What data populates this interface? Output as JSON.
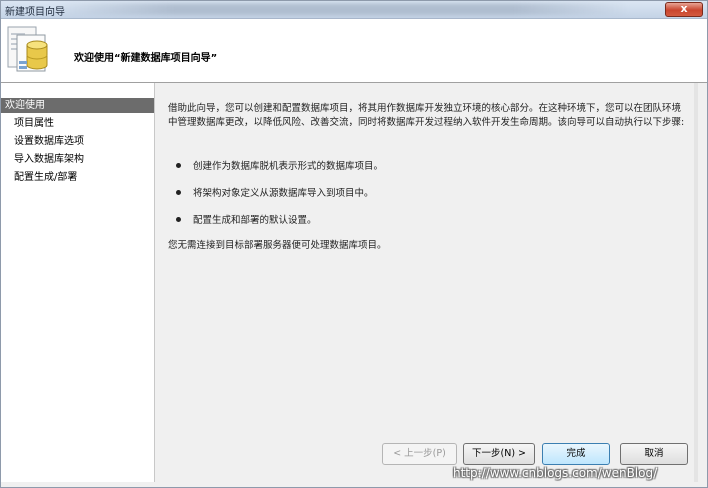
{
  "window": {
    "title": "新建项目向导",
    "close_label": "x"
  },
  "header": {
    "icon": "database-project-icon",
    "title": "欢迎使用“新建数据库项目向导”"
  },
  "nav": {
    "items": [
      {
        "label": "欢迎使用",
        "selected": true
      },
      {
        "label": "项目属性",
        "selected": false
      },
      {
        "label": "设置数据库选项",
        "selected": false
      },
      {
        "label": "导入数据库架构",
        "selected": false
      },
      {
        "label": "配置生成/部署",
        "selected": false
      }
    ]
  },
  "content": {
    "intro": "借助此向导，您可以创建和配置数据库项目，将其用作数据库开发独立环境的核心部分。在这种环境下，您可以在团队环境中管理数据库更改，以降低风险、改善交流，同时将数据库开发过程纳入软件开发生命周期。该向导可以自动执行以下步骤:",
    "bullets": [
      "创建作为数据库脱机表示形式的数据库项目。",
      "将架构对象定义从源数据库导入到项目中。",
      "配置生成和部署的默认设置。"
    ],
    "footer": "您无需连接到目标部署服务器便可处理数据库项目。"
  },
  "buttons": {
    "prev": "< 上一步(P)",
    "next": "下一步(N) >",
    "finish": "完成",
    "cancel": "取消"
  },
  "watermark": "http://www.cnblogs.com/wenBlog/",
  "colors": {
    "nav_selected_bg": "#6c6c6c",
    "content_bg": "#f0f0f0",
    "close_button": "#c9452e"
  }
}
